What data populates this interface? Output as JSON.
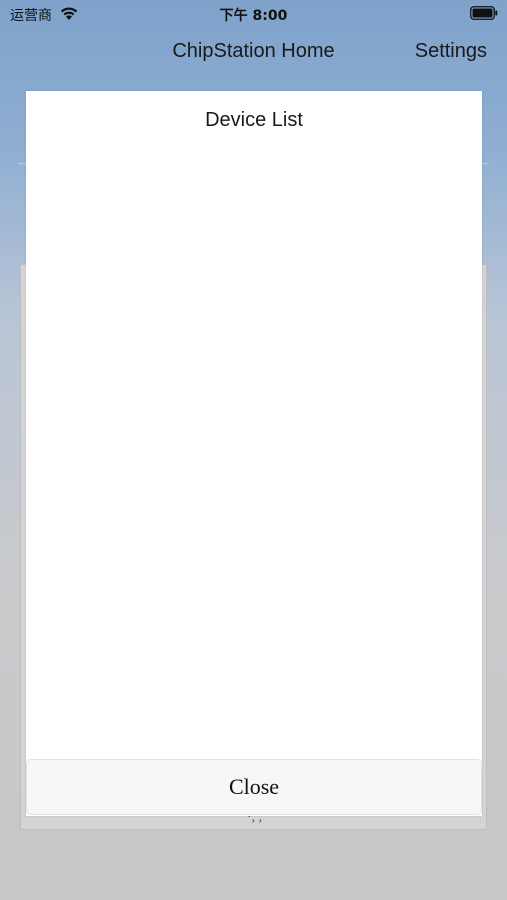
{
  "status_bar": {
    "carrier": "运营商",
    "time": "下午 8:00"
  },
  "nav": {
    "title": "ChipStation Home",
    "settings_label": "Settings"
  },
  "background": {
    "partial_text": "·, ,"
  },
  "modal": {
    "title": "Device List",
    "devices": [],
    "close_label": "Close"
  },
  "icons": {
    "wifi": "wifi-icon",
    "battery": "battery-icon"
  }
}
